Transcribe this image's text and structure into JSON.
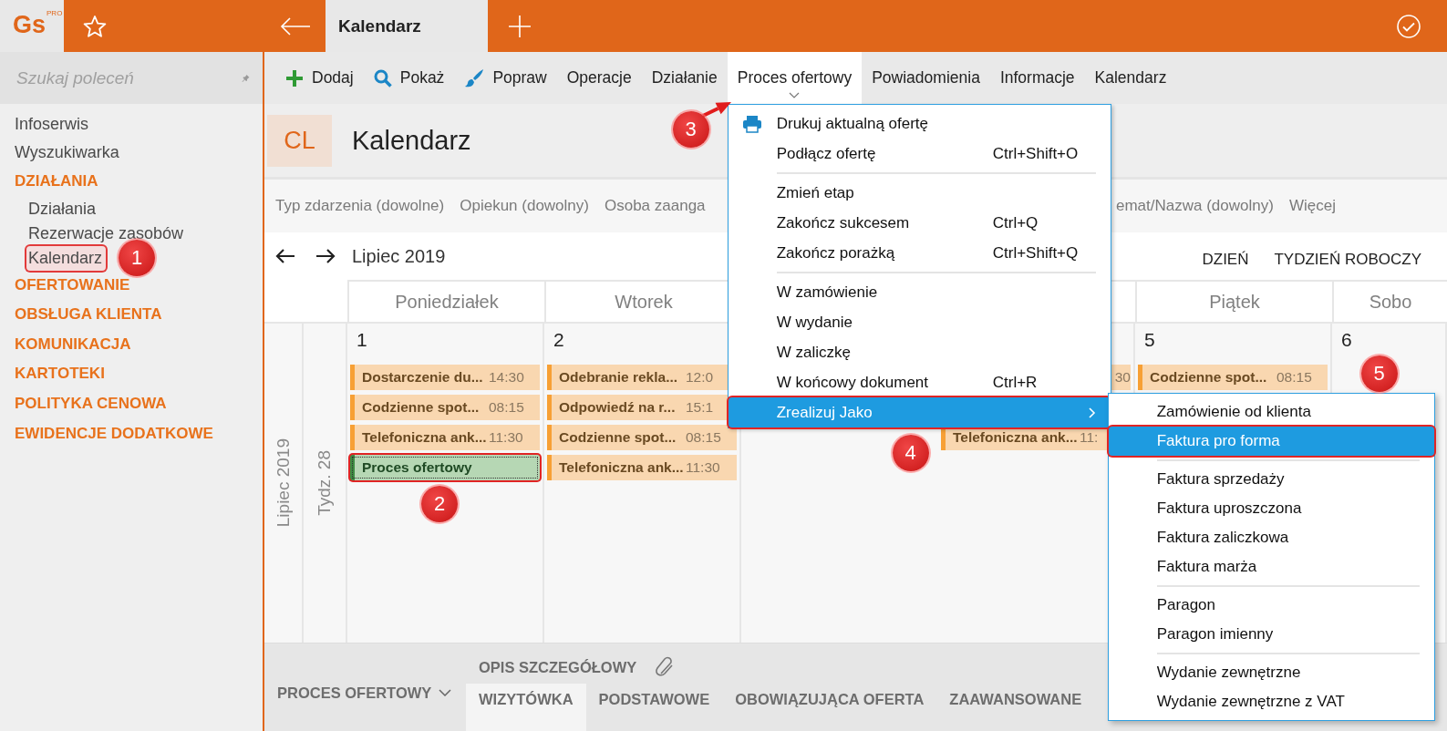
{
  "top_bar": {
    "logo": {
      "text": "Gs",
      "badge": "PRO"
    },
    "tabs": [
      {
        "label": "Kalendarz",
        "selected": true
      }
    ]
  },
  "sidebar": {
    "search": {
      "placeholder": "Szukaj poleceń"
    },
    "items": [
      {
        "label": "Infoserwis",
        "kind": "link",
        "selected": false
      },
      {
        "label": "Wyszukiwarka",
        "kind": "link",
        "selected": false
      },
      {
        "label": "DZIAŁANIA",
        "kind": "section",
        "selected": false,
        "children": [
          {
            "label": "Działania",
            "selected": false
          },
          {
            "label": "Rezerwacje zasobów",
            "selected": false
          },
          {
            "label": "Kalendarz",
            "selected": true,
            "marker": "1"
          }
        ]
      },
      {
        "label": "OFERTOWANIE",
        "kind": "section",
        "selected": false
      },
      {
        "label": "OBSŁUGA KLIENTA",
        "kind": "section",
        "selected": false
      },
      {
        "label": "KOMUNIKACJA",
        "kind": "section",
        "selected": false
      },
      {
        "label": "KARTOTEKI",
        "kind": "section",
        "selected": false
      },
      {
        "label": "POLITYKA CENOWA",
        "kind": "section",
        "selected": false
      },
      {
        "label": "EWIDENCJE DODATKOWE",
        "kind": "section",
        "selected": false
      }
    ]
  },
  "toolbar": [
    {
      "label": "Dodaj",
      "expanded": false
    },
    {
      "label": "Pokaż",
      "expanded": false
    },
    {
      "label": "Popraw",
      "expanded": false
    },
    {
      "label": "Operacje",
      "expanded": false
    },
    {
      "label": "Działanie",
      "expanded": false
    },
    {
      "label": "Proces ofertowy",
      "expanded": true,
      "marker": "3"
    },
    {
      "label": "Powiadomienia",
      "expanded": false
    },
    {
      "label": "Informacje",
      "expanded": false
    },
    {
      "label": "Kalendarz",
      "expanded": false
    }
  ],
  "page_header": {
    "badge": "CL",
    "title": "Kalendarz"
  },
  "filters": [
    "Typ zdarzenia (dowolne)",
    "Opiekun (dowolny)",
    "Osoba zaanga",
    "emat/Nazwa (dowolny)",
    "Więcej"
  ],
  "calendar": {
    "title": "Lipiec 2019",
    "views": [
      "DZIEŃ",
      "TYDZIEŃ ROBOCZY"
    ],
    "month_label": "Lipiec 2019",
    "week_label": "Tydz. 28",
    "days": [
      {
        "header": "Poniedziałek",
        "date": "1",
        "events": [
          {
            "title": "Dostarczenie du...",
            "time": "14:30",
            "kind": "task",
            "selected": false
          },
          {
            "title": "Codzienne spot...",
            "time": "08:15",
            "kind": "task",
            "selected": false
          },
          {
            "title": "Telefoniczna ank...",
            "time": "11:30",
            "kind": "task",
            "selected": false
          },
          {
            "title": "Proces ofertowy",
            "kind": "process",
            "selected": true,
            "marker": "2"
          }
        ]
      },
      {
        "header": "Wtorek",
        "date": "2",
        "events": [
          {
            "title": "Odebranie rekla...",
            "time": "12:0",
            "kind": "task",
            "selected": false
          },
          {
            "title": "Odpowiedź na r...",
            "time": "15:1",
            "kind": "task",
            "selected": false
          },
          {
            "title": "Codzienne spot...",
            "time": "08:15",
            "kind": "task",
            "selected": false
          },
          {
            "title": "Telefoniczna ank...",
            "time": "11:30",
            "kind": "task",
            "selected": false
          }
        ]
      },
      {
        "events": [
          {
            "time": "30",
            "kind": "task",
            "selected": false
          },
          {
            "title": "Telefoniczna ank...",
            "time": "11:",
            "kind": "task",
            "selected": false
          }
        ]
      },
      {
        "header": "Piątek",
        "date": "5",
        "events": [
          {
            "title": "Codzienne spot...",
            "time": "08:15",
            "kind": "task",
            "selected": false
          }
        ]
      },
      {
        "header": "Sobo",
        "date": "6"
      }
    ]
  },
  "bottom_panel": {
    "section": "PROCES OFERTOWY",
    "detail_tab": "OPIS SZCZEGÓŁOWY",
    "tabs": [
      {
        "label": "WIZYTÓWKA",
        "selected": true
      },
      {
        "label": "PODSTAWOWE",
        "selected": false
      },
      {
        "label": "OBOWIĄZUJĄCA OFERTA",
        "selected": false
      },
      {
        "label": "ZAAWANSOWANE",
        "selected": false
      }
    ]
  },
  "dropdown_menu": {
    "items": [
      {
        "label": "Drukuj aktualną ofertę",
        "kind": "item",
        "selected": false
      },
      {
        "label": "Podłącz ofertę",
        "shortcut": "Ctrl+Shift+O",
        "kind": "item",
        "selected": false
      },
      {
        "kind": "separator"
      },
      {
        "label": "Zmień etap",
        "kind": "item",
        "selected": false
      },
      {
        "label": "Zakończ sukcesem",
        "shortcut": "Ctrl+Q",
        "kind": "item",
        "selected": false
      },
      {
        "label": "Zakończ porażką",
        "shortcut": "Ctrl+Shift+Q",
        "kind": "item",
        "selected": false
      },
      {
        "kind": "separator"
      },
      {
        "label": "W zamówienie",
        "kind": "item",
        "selected": false
      },
      {
        "label": "W wydanie",
        "kind": "item",
        "selected": false
      },
      {
        "label": "W zaliczkę",
        "kind": "item",
        "selected": false
      },
      {
        "label": "W końcowy dokument",
        "shortcut": "Ctrl+R",
        "kind": "item",
        "selected": false
      },
      {
        "label": "Zrealizuj Jako",
        "kind": "submenu",
        "selected": true,
        "marker": "4"
      }
    ]
  },
  "submenu": {
    "items": [
      {
        "label": "Zamówienie od klienta",
        "kind": "item",
        "selected": false
      },
      {
        "label": "Faktura pro forma",
        "kind": "item",
        "selected": true,
        "marker": "5"
      },
      {
        "kind": "separator"
      },
      {
        "label": "Faktura sprzedaży",
        "kind": "item",
        "selected": false
      },
      {
        "label": "Faktura uproszczona",
        "kind": "item",
        "selected": false
      },
      {
        "label": "Faktura zaliczkowa",
        "kind": "item",
        "selected": false
      },
      {
        "label": "Faktura marża",
        "kind": "item",
        "selected": false
      },
      {
        "kind": "separator"
      },
      {
        "label": "Paragon",
        "kind": "item",
        "selected": false
      },
      {
        "label": "Paragon imienny",
        "kind": "item",
        "selected": false
      },
      {
        "kind": "separator"
      },
      {
        "label": "Wydanie zewnętrzne",
        "kind": "item",
        "selected": false
      },
      {
        "label": "Wydanie zewnętrzne z VAT",
        "kind": "item",
        "selected": false
      }
    ]
  }
}
